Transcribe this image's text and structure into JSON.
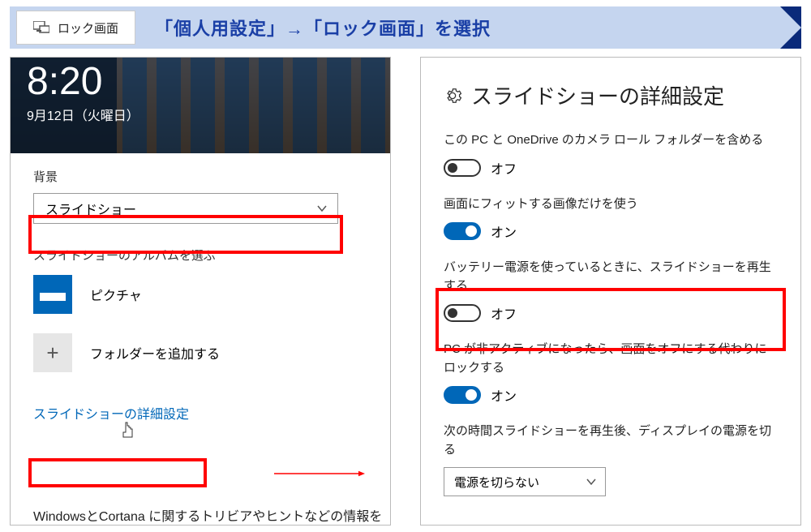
{
  "banner": {
    "left_label": "ロック画面",
    "title": "「個人用設定」→「ロック画面」を選択"
  },
  "left_panel": {
    "lock_time": "8:20",
    "lock_date": "9月12日（火曜日）",
    "background_label": "背景",
    "background_value": "スライドショー",
    "album_label": "スライドショーのアルバムを選ぶ",
    "album_pictures": "ピクチャ",
    "add_folder": "フォルダーを追加する",
    "advanced_link": "スライドショーの詳細設定",
    "footer_text": "WindowsとCortana に関するトリビアやヒントなどの情報を"
  },
  "right_panel": {
    "title": "スライドショーの詳細設定",
    "settings": [
      {
        "label": "この PC と OneDrive のカメラ ロール フォルダーを含める",
        "state": "off",
        "state_label": "オフ"
      },
      {
        "label": "画面にフィットする画像だけを使う",
        "state": "on",
        "state_label": "オン"
      },
      {
        "label": "バッテリー電源を使っているときに、スライドショーを再生する",
        "state": "off",
        "state_label": "オフ"
      },
      {
        "label": "PC が非アクティブになったら、画面をオフにする代わりにロックする",
        "state": "on",
        "state_label": "オン"
      }
    ],
    "duration_label": "次の時間スライドショーを再生後、ディスプレイの電源を切る",
    "duration_value": "電源を切らない"
  }
}
